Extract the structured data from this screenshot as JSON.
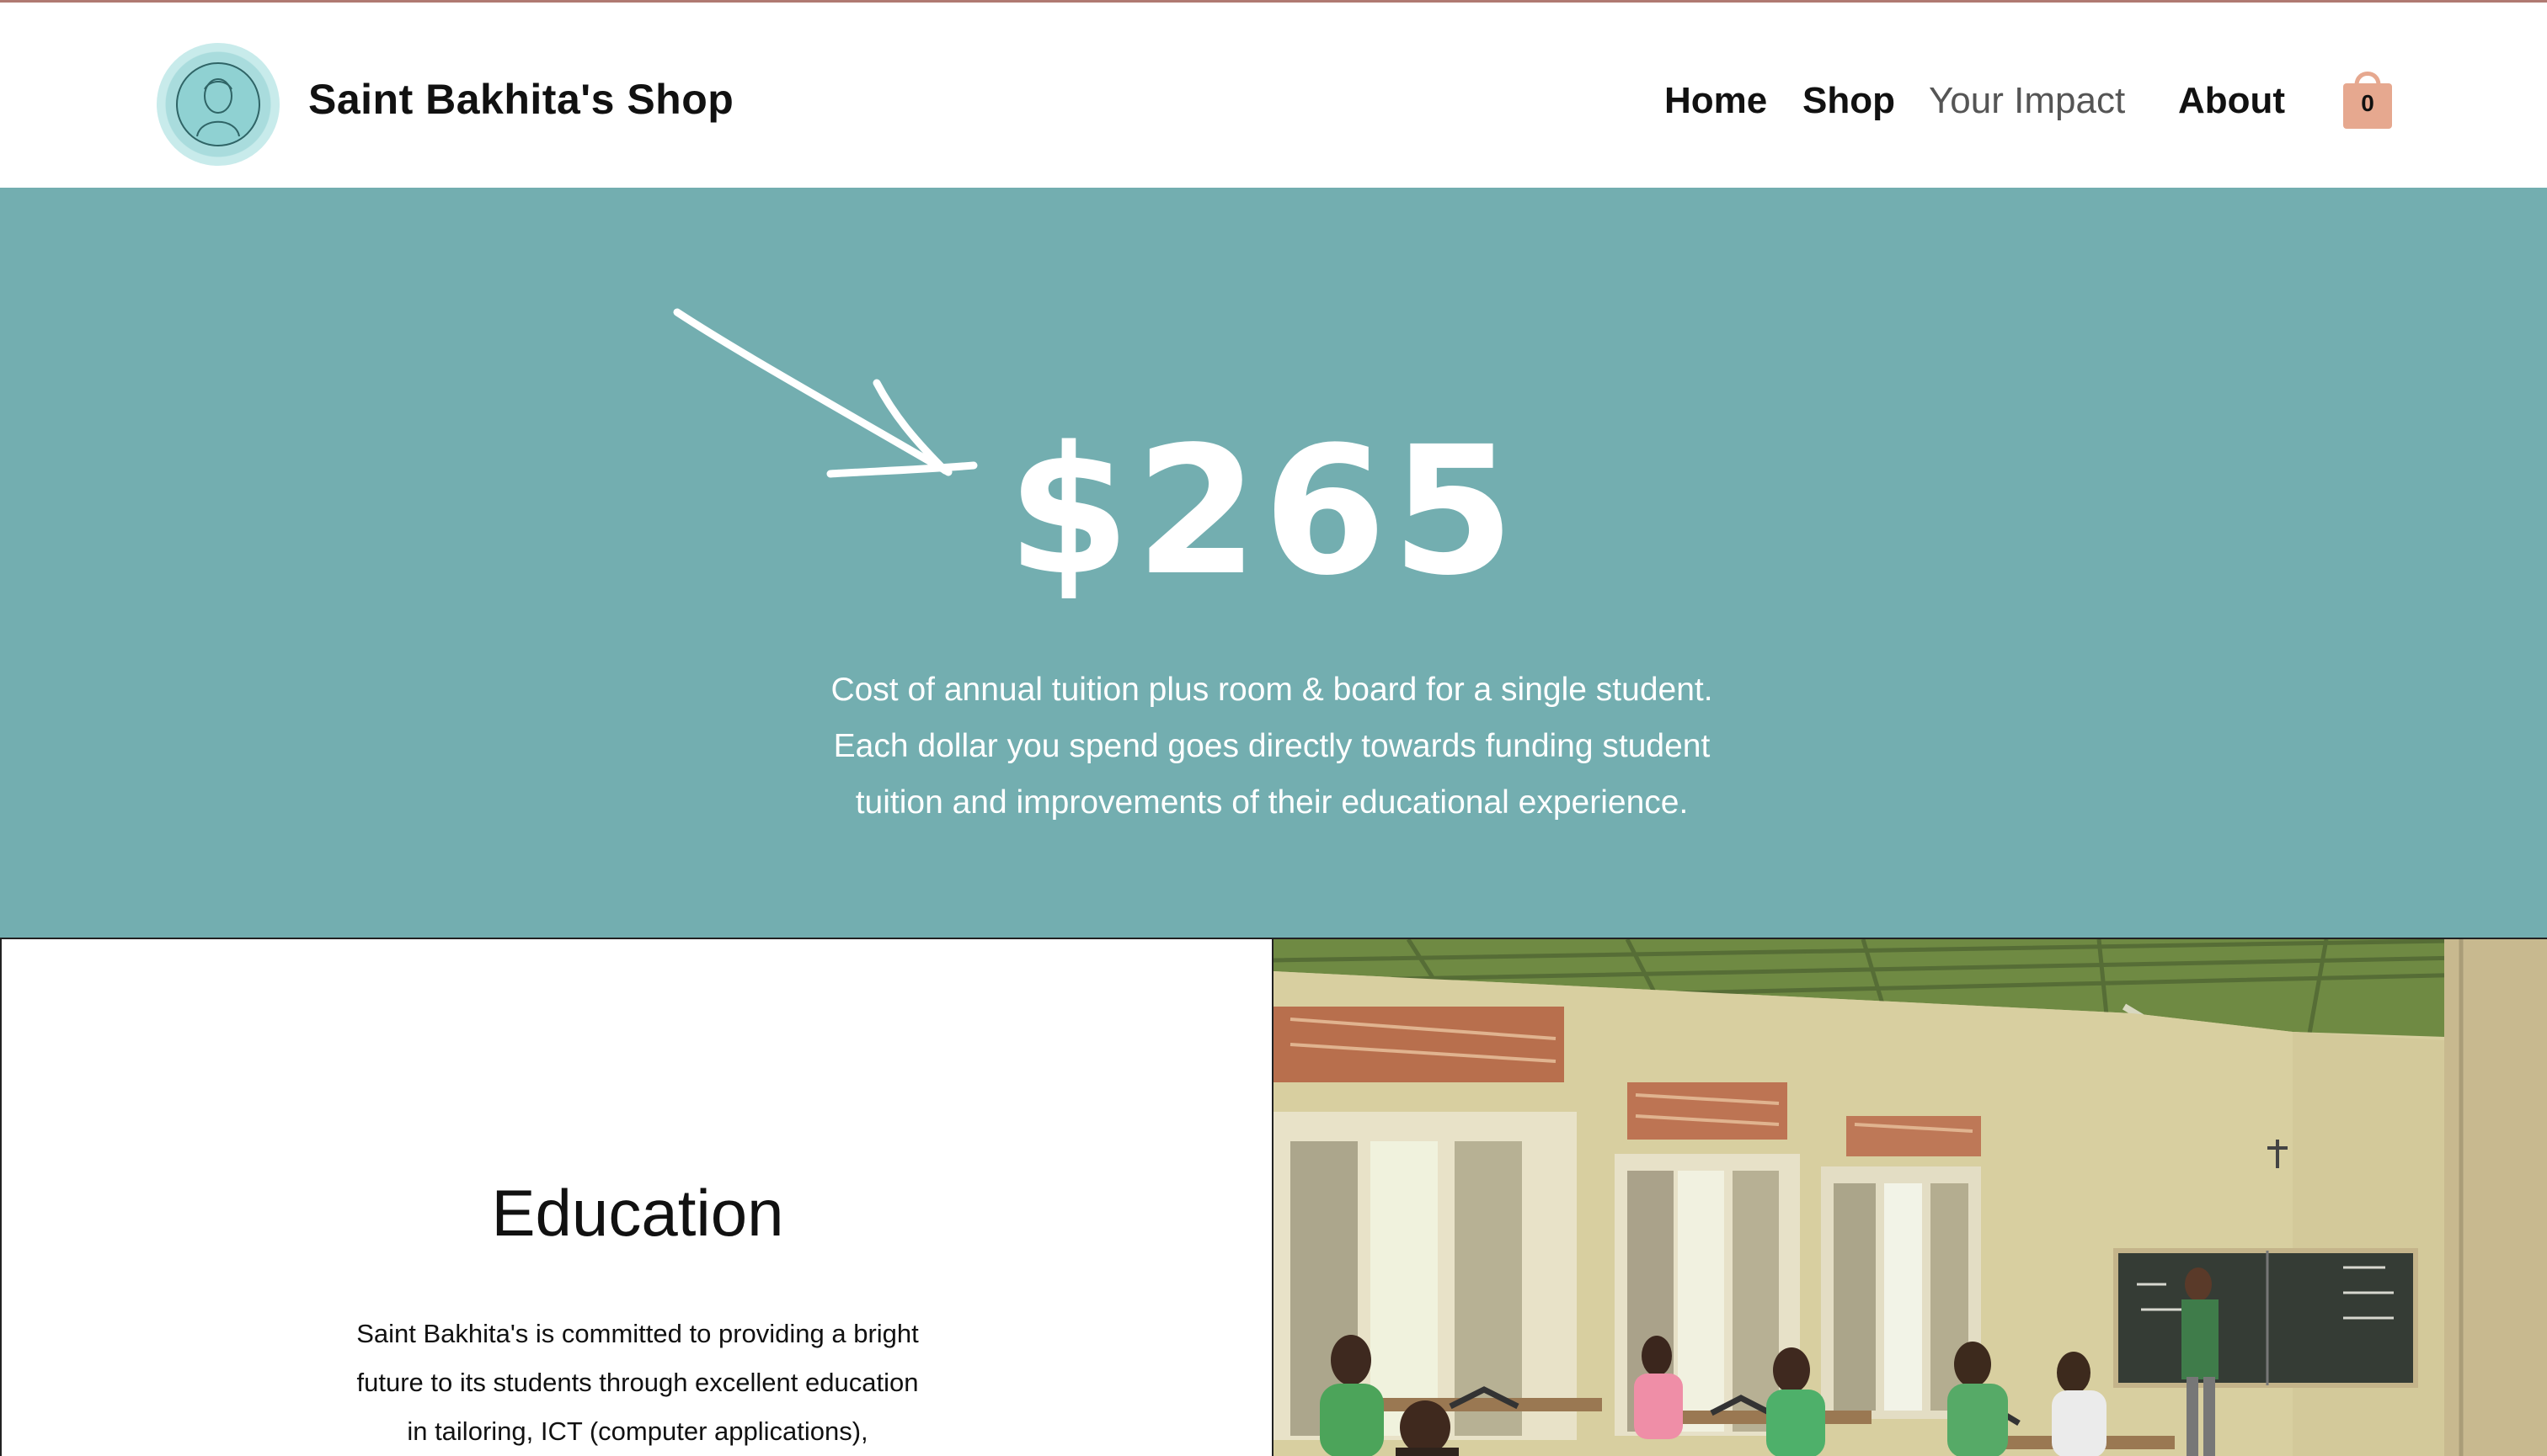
{
  "header": {
    "shop_name": "Saint Bakhita's Shop",
    "nav": [
      "Home",
      "Shop",
      "Your Impact",
      "About"
    ],
    "active_nav": "Your Impact",
    "cart_count": "0"
  },
  "hero": {
    "price": "$265",
    "description_lines": [
      "Cost of annual tuition plus room & board for a single student.",
      "Each dollar you spend goes directly towards funding student",
      "tuition and improvements of their educational experience."
    ]
  },
  "education": {
    "title": "Education",
    "text_lines": [
      "Saint Bakhita's is committed to providing a bright",
      "future to its students through excellent education",
      "in tailoring, ICT (computer applications),"
    ]
  },
  "colors": {
    "hero_bg": "#73aeb0",
    "cart": "#e6a88f",
    "logo": "#a9dcdd"
  },
  "icons": {
    "logo": "school-seal-icon",
    "cart": "shopping-bag-icon",
    "arrow": "hand-drawn-arrow-icon"
  }
}
